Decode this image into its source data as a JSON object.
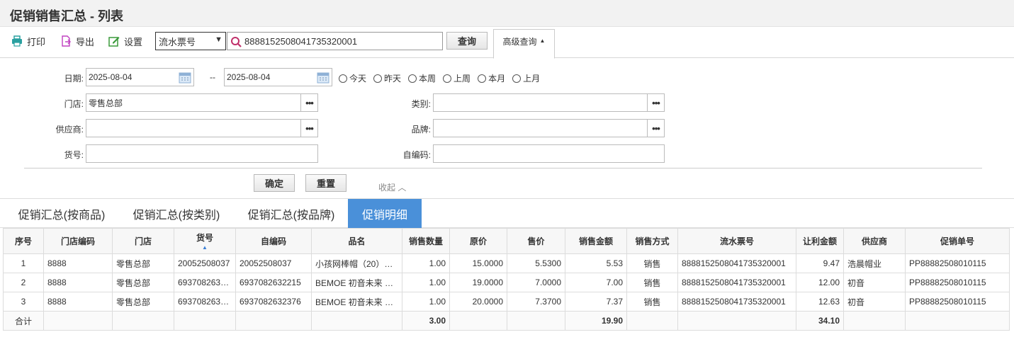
{
  "page": {
    "title": "促销销售汇总 - 列表"
  },
  "toolbar": {
    "print": "打印",
    "export": "导出",
    "settings": "设置",
    "search_field": "流水票号",
    "search_value": "8888152508041735320001",
    "query": "查询",
    "advanced": "高级查询"
  },
  "filters": {
    "date_label": "日期:",
    "date_from": "2025-08-04",
    "date_sep": "--",
    "date_to": "2025-08-04",
    "quick_ranges": [
      "今天",
      "昨天",
      "本周",
      "上周",
      "本月",
      "上月"
    ],
    "store_label": "门店:",
    "store_value": "零售总部",
    "category_label": "类别:",
    "category_value": "",
    "supplier_label": "供应商:",
    "supplier_value": "",
    "brand_label": "品牌:",
    "brand_value": "",
    "sku_label": "货号:",
    "sku_value": "",
    "selfcode_label": "自编码:",
    "selfcode_value": "",
    "confirm": "确定",
    "reset": "重置",
    "collapse": "收起"
  },
  "tabs": [
    {
      "label": "促销汇总(按商品)",
      "active": false
    },
    {
      "label": "促销汇总(按类别)",
      "active": false
    },
    {
      "label": "促销汇总(按品牌)",
      "active": false
    },
    {
      "label": "促销明细",
      "active": true
    }
  ],
  "table": {
    "columns": [
      "序号",
      "门店编码",
      "门店",
      "货号",
      "自编码",
      "品名",
      "销售数量",
      "原价",
      "售价",
      "销售金额",
      "销售方式",
      "流水票号",
      "让利金额",
      "供应商",
      "促销单号"
    ],
    "rows": [
      [
        "1",
        "8888",
        "零售总部",
        "20052508037",
        "20052508037",
        "小孩网棒帽（20）…",
        "1.00",
        "15.0000",
        "5.5300",
        "5.53",
        "销售",
        "8888152508041735320001",
        "9.47",
        "浩晨帽业",
        "PP88882508010115"
      ],
      [
        "2",
        "8888",
        "零售总部",
        "693708263…",
        "6937082632215",
        "BEMOE 初音未来 …",
        "1.00",
        "19.0000",
        "7.0000",
        "7.00",
        "销售",
        "8888152508041735320001",
        "12.00",
        "初音",
        "PP88882508010115"
      ],
      [
        "3",
        "8888",
        "零售总部",
        "693708263…",
        "6937082632376",
        "BEMOE 初音未来 …",
        "1.00",
        "20.0000",
        "7.3700",
        "7.37",
        "销售",
        "8888152508041735320001",
        "12.63",
        "初音",
        "PP88882508010115"
      ]
    ],
    "total": {
      "label": "合计",
      "qty": "3.00",
      "amount": "19.90",
      "discount": "34.10"
    }
  },
  "colors": {
    "tab_active": "#4a90d9",
    "sort_arrow": "#3b7fd4"
  }
}
